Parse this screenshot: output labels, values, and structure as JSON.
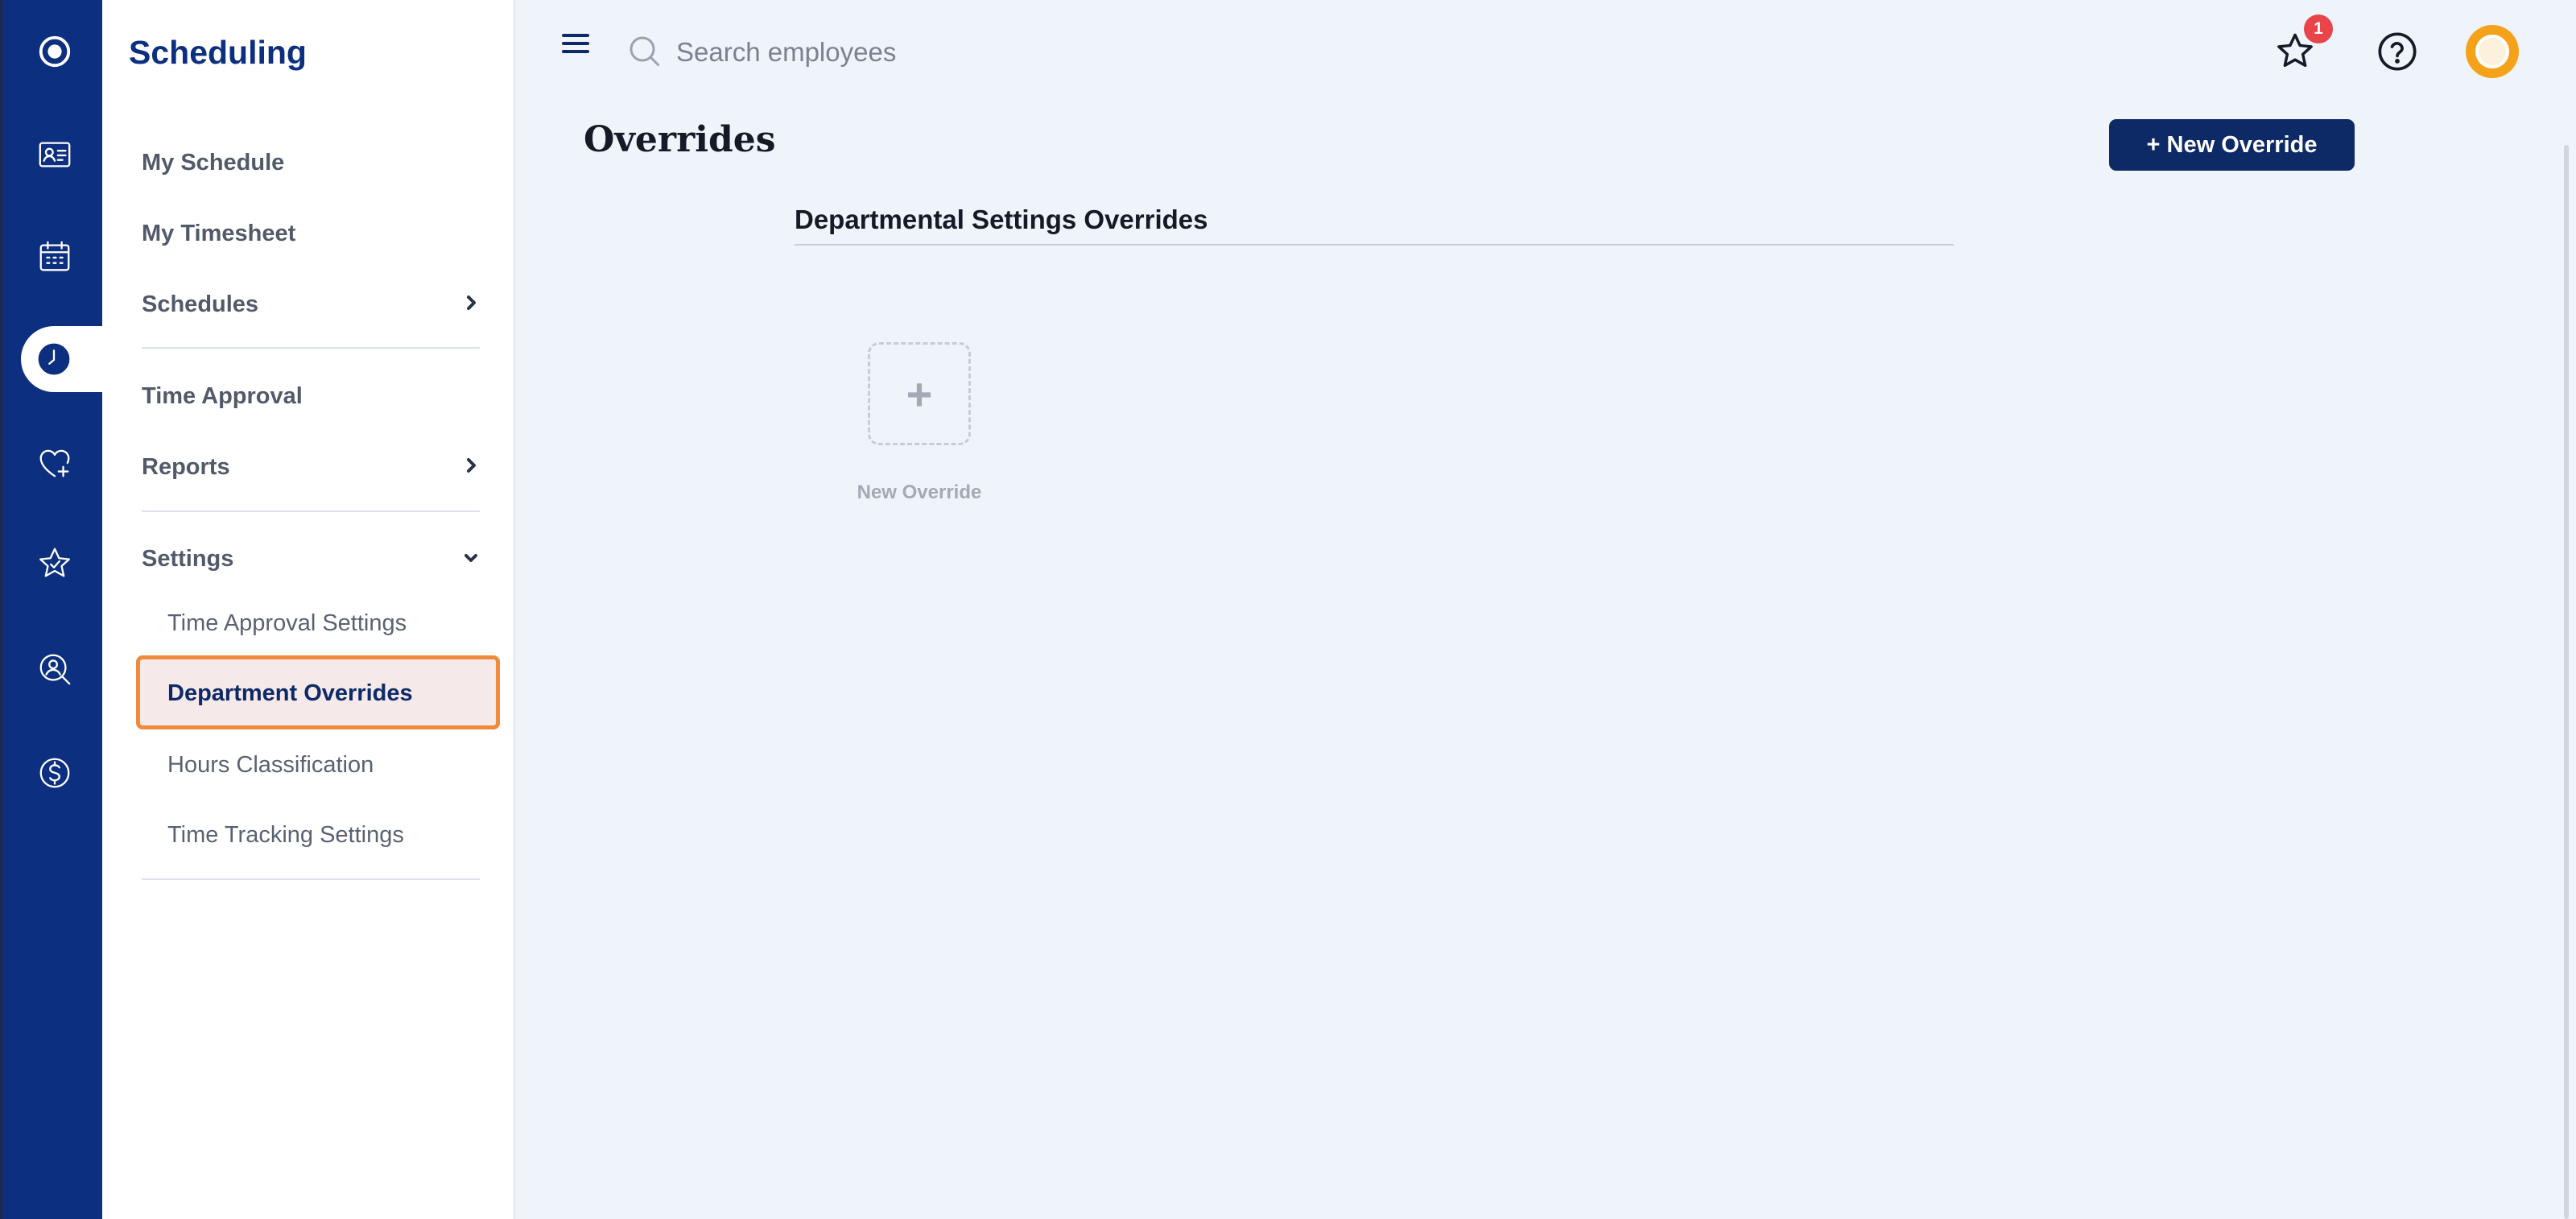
{
  "sidebar": {
    "title": "Scheduling",
    "items": {
      "my_schedule": "My Schedule",
      "my_timesheet": "My Timesheet",
      "schedules": "Schedules",
      "time_approval": "Time Approval",
      "reports": "Reports",
      "settings": "Settings"
    },
    "settings_sub": {
      "time_approval_settings": "Time Approval Settings",
      "department_overrides": "Department Overrides",
      "hours_classification": "Hours Classification",
      "time_tracking_settings": "Time Tracking Settings"
    },
    "selected_highlight": "#f08a3c"
  },
  "rail": {
    "icons": [
      "app-logo-icon",
      "id-card-icon",
      "calendar-icon",
      "clock-icon",
      "heart-plus-icon",
      "star-icon",
      "person-search-icon",
      "dollar-icon"
    ],
    "active": "clock-icon",
    "color": "#0d2f7f"
  },
  "topbar": {
    "search_placeholder": "Search employees",
    "notification_count": "1"
  },
  "main": {
    "title": "Overrides",
    "new_button": "+ New Override",
    "section_title": "Departmental Settings Overrides",
    "add_tile_symbol": "+",
    "add_tile_label": "New Override"
  }
}
